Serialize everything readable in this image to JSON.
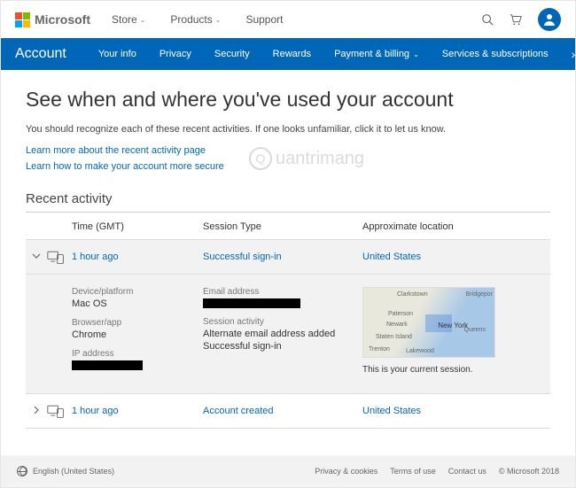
{
  "topbar": {
    "brand": "Microsoft",
    "nav": {
      "store": "Store",
      "products": "Products",
      "support": "Support"
    }
  },
  "bluenav": {
    "brand": "Account",
    "items": {
      "yourinfo": "Your info",
      "privacy": "Privacy",
      "security": "Security",
      "rewards": "Rewards",
      "payment": "Payment & billing",
      "services": "Services & subscriptions"
    }
  },
  "page": {
    "title": "See when and where you've used your account",
    "desc": "You should recognize each of these recent activities. If one looks unfamiliar, click it to let us know.",
    "link1": "Learn more about the recent activity page",
    "link2": "Learn how to make your account more secure",
    "section": "Recent activity"
  },
  "columns": {
    "time": "Time (GMT)",
    "session": "Session Type",
    "loc": "Approximate location"
  },
  "activities": [
    {
      "time": "1 hour ago",
      "session": "Successful sign-in",
      "location": "United States",
      "expanded": true,
      "detail": {
        "device_label": "Device/platform",
        "device": "Mac OS",
        "browser_label": "Browser/app",
        "browser": "Chrome",
        "ip_label": "IP address",
        "email_label": "Email address",
        "activity_label": "Session activity",
        "activity1": "Alternate email address added",
        "activity2": "Successful sign-in",
        "session_note": "This is your current session.",
        "map_places": {
          "clarkstown": "Clarkstown",
          "bridgeport": "Bridgepor",
          "paterson": "Paterson",
          "newark": "Newark",
          "staten": "Staten Island",
          "trenton": "Trenton",
          "lakewood": "Lakewood",
          "newyork": "New York",
          "queens": "Queens"
        }
      }
    },
    {
      "time": "1 hour ago",
      "session": "Account created",
      "location": "United States",
      "expanded": false
    }
  ],
  "footer": {
    "lang": "English (United States)",
    "links": {
      "privacy": "Privacy & cookies",
      "terms": "Terms of use",
      "contact": "Contact us"
    },
    "copyright": "© Microsoft 2018"
  },
  "watermark": "uantrimang"
}
